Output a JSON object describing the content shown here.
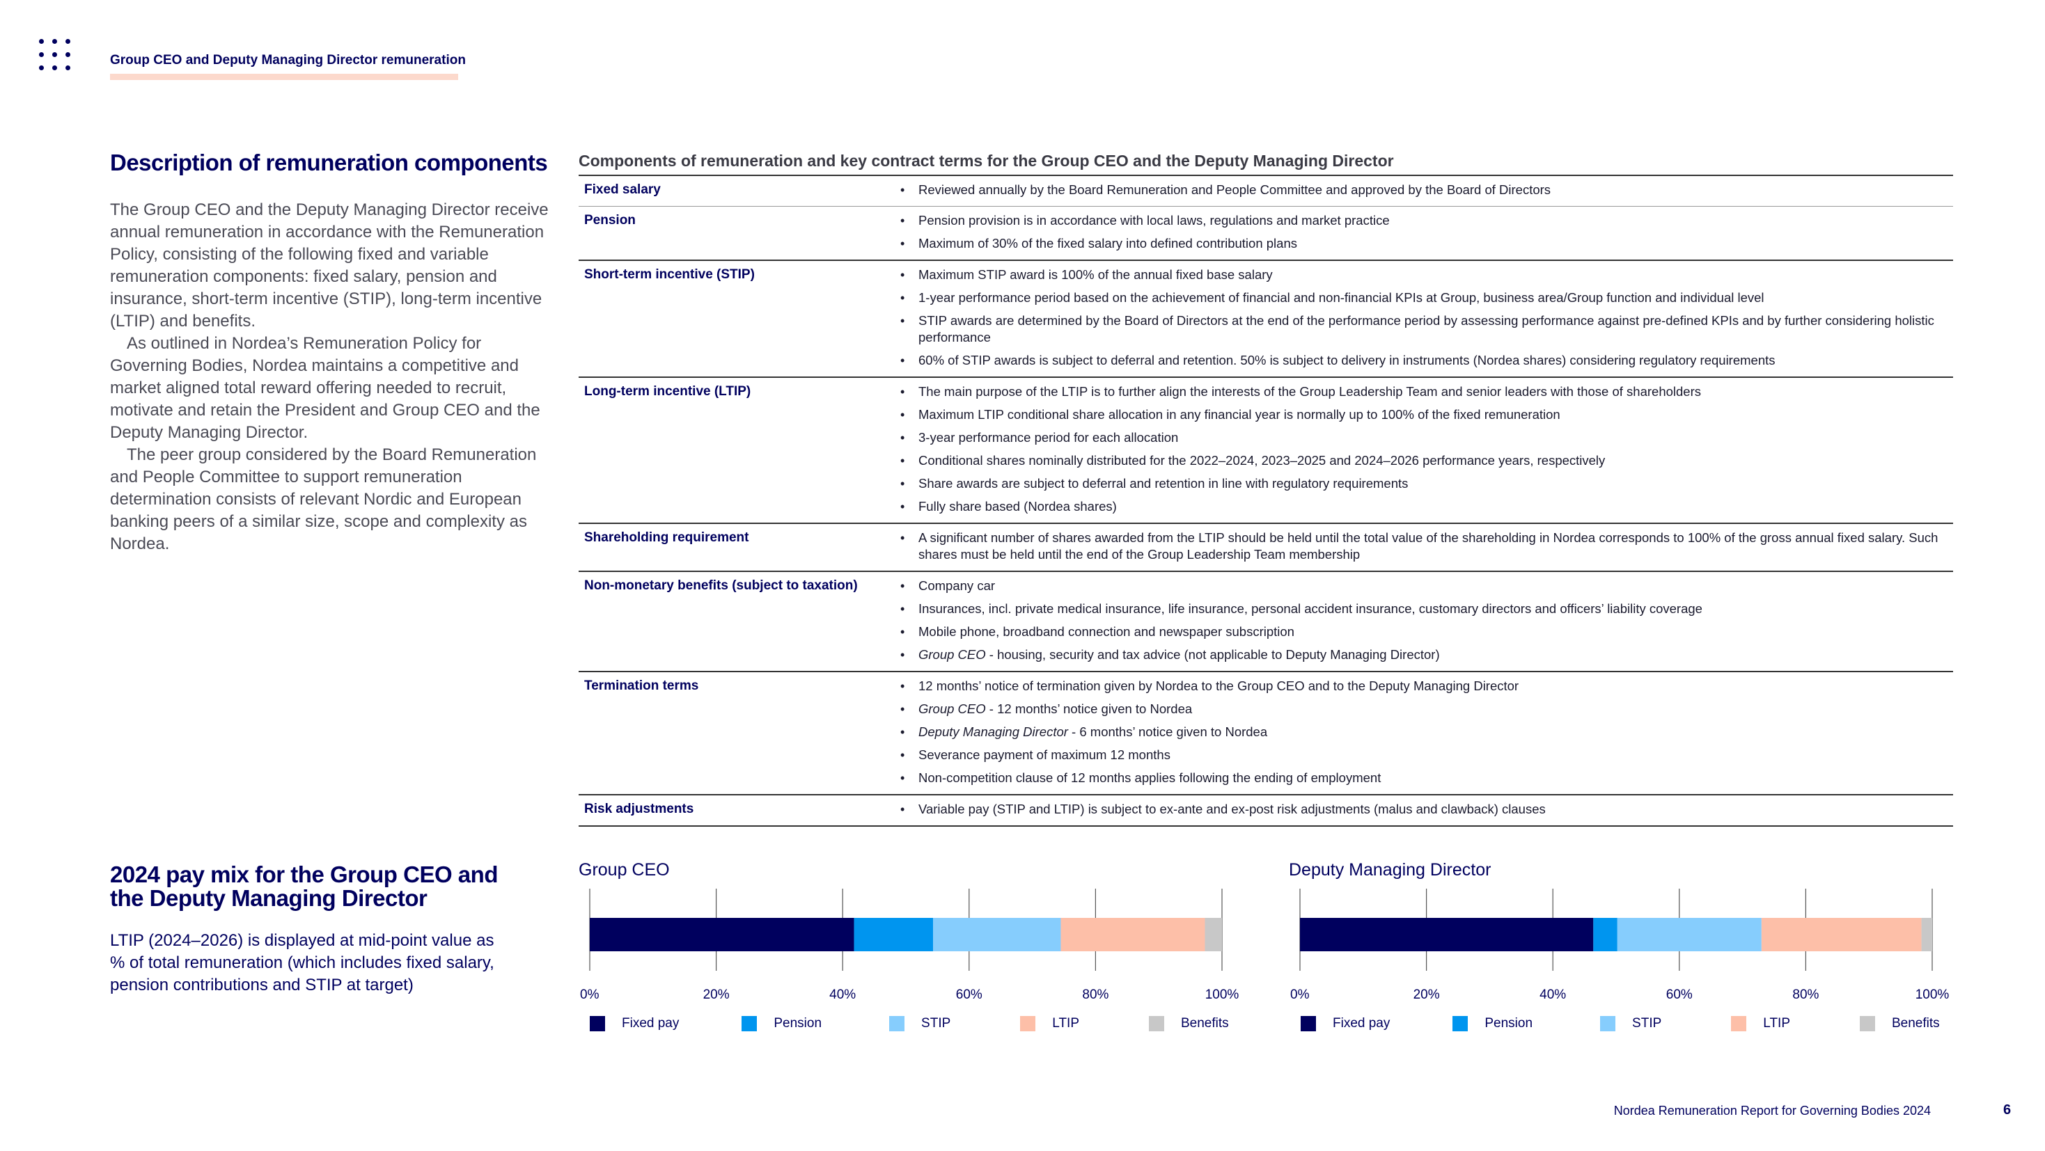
{
  "header": {
    "title": "Group CEO and Deputy Managing Director remuneration"
  },
  "description": {
    "heading": "Description of remuneration components",
    "paragraphs": [
      "The Group CEO and the Deputy Managing Director receive annual remuneration in accordance with the Remuneration Policy, consisting of the following fixed and variable remuneration components: fixed salary, pension and insurance, short-term incentive (STIP), long-term incentive (LTIP) and benefits.",
      "As outlined in Nordea’s Remuneration Policy for Governing Bodies, Nordea maintains a competitive and market aligned total reward offering needed to recruit, motivate and retain the President and Group CEO and the Deputy Managing Director.",
      "The peer group considered by the Board Remuneration and People Committee to support remuneration determination consists of relevant Nordic and European banking peers of a similar size, scope and complexity as Nordea."
    ]
  },
  "table": {
    "title": "Components of remuneration and key contract terms for the Group CEO and the Deputy Managing Director",
    "rows": [
      {
        "label": "Fixed salary",
        "bullets": [
          {
            "text": "Reviewed annually by the Board Remuneration and People Committee and approved by the Board of Directors"
          }
        ]
      },
      {
        "label": "Pension",
        "bullets": [
          {
            "text": "Pension provision is in accordance with local laws, regulations and market practice"
          },
          {
            "text": "Maximum of 30% of the fixed salary into defined contribution plans"
          }
        ]
      },
      {
        "label": "Short-term incentive (STIP)",
        "bullets": [
          {
            "text": "Maximum STIP award is 100% of the annual fixed base salary"
          },
          {
            "text": "1-year performance period based on the achievement of financial and non-financial KPIs at Group, business area/Group function and individual level"
          },
          {
            "text": "STIP awards are determined by the Board of Directors at the end of the performance period by assessing performance against pre-defined KPIs and by further considering holistic performance"
          },
          {
            "text": "60% of STIP awards is subject to deferral and retention. 50% is subject to delivery in instruments (Nordea shares) considering regulatory requirements"
          }
        ]
      },
      {
        "label": "Long-term incentive (LTIP)",
        "bullets": [
          {
            "text": "The main purpose of the LTIP is to further align the interests of the Group Leadership Team and senior leaders with those of shareholders"
          },
          {
            "text": "Maximum LTIP conditional share allocation in any financial year is normally up to 100% of the fixed remuneration"
          },
          {
            "text": "3-year performance period for each allocation"
          },
          {
            "text": "Conditional shares nominally distributed for the 2022–2024, 2023–2025 and 2024–2026 performance years, respectively"
          },
          {
            "text": "Share awards are subject to deferral and retention in line with regulatory requirements"
          },
          {
            "text": "Fully share based (Nordea shares)"
          }
        ]
      },
      {
        "label": "Shareholding requirement",
        "bullets": [
          {
            "text": "A significant number of shares awarded from the LTIP should be held until the total value of the shareholding in Nordea corresponds to 100% of the gross annual fixed salary. Such shares must be held until the end of the Group Leadership Team membership"
          }
        ]
      },
      {
        "label": "Non-monetary benefits (subject to taxation)",
        "bullets": [
          {
            "text": "Company car"
          },
          {
            "text": "Insurances, incl. private medical insurance, life insurance, personal accident insurance, customary directors and officers’ liability coverage"
          },
          {
            "text": "Mobile phone, broadband connection and newspaper subscription"
          },
          {
            "italic": "Group CEO",
            "text": " - housing, security and tax advice (not applicable to Deputy Managing Director)"
          }
        ]
      },
      {
        "label": "Termination terms",
        "bullets": [
          {
            "text": "12 months’ notice of termination given by Nordea to the Group CEO and to the Deputy Managing Director"
          },
          {
            "italic": "Group CEO",
            "text": "  - 12 months’ notice given to Nordea"
          },
          {
            "italic": "Deputy Managing Director",
            "text": " - 6 months’ notice given to Nordea"
          },
          {
            "text": "Severance payment of maximum 12 months"
          },
          {
            "text": "Non-competition clause of 12 months applies following the ending of employment"
          }
        ]
      },
      {
        "label": "Risk adjustments",
        "bullets": [
          {
            "text": "Variable pay (STIP and LTIP) is subject to ex-ante and ex-post risk adjustments (malus and clawback) clauses"
          }
        ]
      }
    ]
  },
  "paymix": {
    "heading": "2024 pay mix for the Group CEO and the Deputy Managing Director",
    "note": "LTIP (2024–2026) is displayed at mid-point value as % of total remuneration (which includes fixed salary, pension contributions and STIP at target)"
  },
  "colors": {
    "fixed_pay": "#00005e",
    "pension": "#0095ef",
    "stip": "#86cdfd",
    "ltip": "#fdbfa8",
    "benefits": "#c8c8c8"
  },
  "chart_data": [
    {
      "type": "bar",
      "orientation": "horizontal-stacked",
      "title": "Group CEO",
      "xlim": [
        0,
        100
      ],
      "ticks": [
        "0%",
        "20%",
        "40%",
        "60%",
        "80%",
        "100%"
      ],
      "grid": true,
      "legend": "bottom",
      "series": [
        {
          "name": "Fixed pay",
          "value": 41.8,
          "color": "#00005e"
        },
        {
          "name": "Pension",
          "value": 12.5,
          "color": "#0095ef"
        },
        {
          "name": "STIP",
          "value": 20.2,
          "color": "#86cdfd"
        },
        {
          "name": "LTIP",
          "value": 22.8,
          "color": "#fdbfa8"
        },
        {
          "name": "Benefits",
          "value": 2.7,
          "color": "#c8c8c8"
        }
      ]
    },
    {
      "type": "bar",
      "orientation": "horizontal-stacked",
      "title": "Deputy Managing Director",
      "xlim": [
        0,
        100
      ],
      "ticks": [
        "0%",
        "20%",
        "40%",
        "60%",
        "80%",
        "100%"
      ],
      "grid": true,
      "legend": "bottom",
      "series": [
        {
          "name": "Fixed pay",
          "value": 46.4,
          "color": "#00005e"
        },
        {
          "name": "Pension",
          "value": 3.8,
          "color": "#0095ef"
        },
        {
          "name": "STIP",
          "value": 22.8,
          "color": "#86cdfd"
        },
        {
          "name": "LTIP",
          "value": 25.3,
          "color": "#fdbfa8"
        },
        {
          "name": "Benefits",
          "value": 1.7,
          "color": "#c8c8c8"
        }
      ]
    }
  ],
  "footer": {
    "text": "Nordea Remuneration Report for Governing Bodies 2024",
    "page": "6"
  }
}
